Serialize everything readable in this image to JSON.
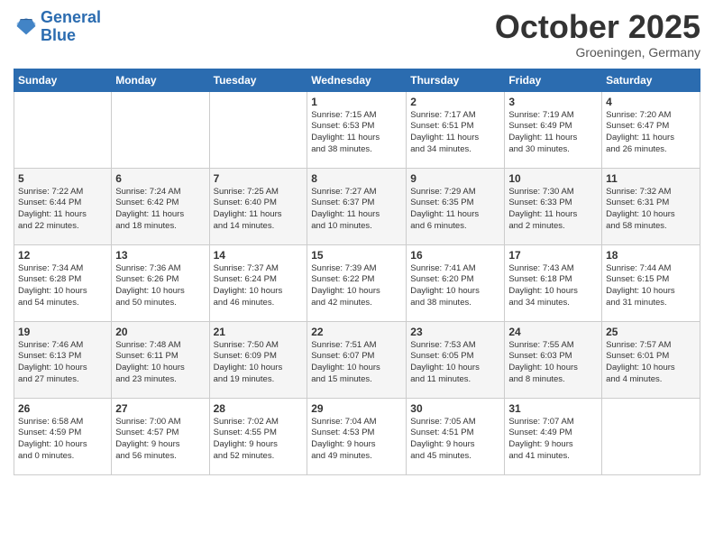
{
  "logo": {
    "line1": "General",
    "line2": "Blue"
  },
  "title": "October 2025",
  "subtitle": "Groeningen, Germany",
  "weekdays": [
    "Sunday",
    "Monday",
    "Tuesday",
    "Wednesday",
    "Thursday",
    "Friday",
    "Saturday"
  ],
  "weeks": [
    [
      {
        "day": "",
        "info": ""
      },
      {
        "day": "",
        "info": ""
      },
      {
        "day": "",
        "info": ""
      },
      {
        "day": "1",
        "info": "Sunrise: 7:15 AM\nSunset: 6:53 PM\nDaylight: 11 hours\nand 38 minutes."
      },
      {
        "day": "2",
        "info": "Sunrise: 7:17 AM\nSunset: 6:51 PM\nDaylight: 11 hours\nand 34 minutes."
      },
      {
        "day": "3",
        "info": "Sunrise: 7:19 AM\nSunset: 6:49 PM\nDaylight: 11 hours\nand 30 minutes."
      },
      {
        "day": "4",
        "info": "Sunrise: 7:20 AM\nSunset: 6:47 PM\nDaylight: 11 hours\nand 26 minutes."
      }
    ],
    [
      {
        "day": "5",
        "info": "Sunrise: 7:22 AM\nSunset: 6:44 PM\nDaylight: 11 hours\nand 22 minutes."
      },
      {
        "day": "6",
        "info": "Sunrise: 7:24 AM\nSunset: 6:42 PM\nDaylight: 11 hours\nand 18 minutes."
      },
      {
        "day": "7",
        "info": "Sunrise: 7:25 AM\nSunset: 6:40 PM\nDaylight: 11 hours\nand 14 minutes."
      },
      {
        "day": "8",
        "info": "Sunrise: 7:27 AM\nSunset: 6:37 PM\nDaylight: 11 hours\nand 10 minutes."
      },
      {
        "day": "9",
        "info": "Sunrise: 7:29 AM\nSunset: 6:35 PM\nDaylight: 11 hours\nand 6 minutes."
      },
      {
        "day": "10",
        "info": "Sunrise: 7:30 AM\nSunset: 6:33 PM\nDaylight: 11 hours\nand 2 minutes."
      },
      {
        "day": "11",
        "info": "Sunrise: 7:32 AM\nSunset: 6:31 PM\nDaylight: 10 hours\nand 58 minutes."
      }
    ],
    [
      {
        "day": "12",
        "info": "Sunrise: 7:34 AM\nSunset: 6:28 PM\nDaylight: 10 hours\nand 54 minutes."
      },
      {
        "day": "13",
        "info": "Sunrise: 7:36 AM\nSunset: 6:26 PM\nDaylight: 10 hours\nand 50 minutes."
      },
      {
        "day": "14",
        "info": "Sunrise: 7:37 AM\nSunset: 6:24 PM\nDaylight: 10 hours\nand 46 minutes."
      },
      {
        "day": "15",
        "info": "Sunrise: 7:39 AM\nSunset: 6:22 PM\nDaylight: 10 hours\nand 42 minutes."
      },
      {
        "day": "16",
        "info": "Sunrise: 7:41 AM\nSunset: 6:20 PM\nDaylight: 10 hours\nand 38 minutes."
      },
      {
        "day": "17",
        "info": "Sunrise: 7:43 AM\nSunset: 6:18 PM\nDaylight: 10 hours\nand 34 minutes."
      },
      {
        "day": "18",
        "info": "Sunrise: 7:44 AM\nSunset: 6:15 PM\nDaylight: 10 hours\nand 31 minutes."
      }
    ],
    [
      {
        "day": "19",
        "info": "Sunrise: 7:46 AM\nSunset: 6:13 PM\nDaylight: 10 hours\nand 27 minutes."
      },
      {
        "day": "20",
        "info": "Sunrise: 7:48 AM\nSunset: 6:11 PM\nDaylight: 10 hours\nand 23 minutes."
      },
      {
        "day": "21",
        "info": "Sunrise: 7:50 AM\nSunset: 6:09 PM\nDaylight: 10 hours\nand 19 minutes."
      },
      {
        "day": "22",
        "info": "Sunrise: 7:51 AM\nSunset: 6:07 PM\nDaylight: 10 hours\nand 15 minutes."
      },
      {
        "day": "23",
        "info": "Sunrise: 7:53 AM\nSunset: 6:05 PM\nDaylight: 10 hours\nand 11 minutes."
      },
      {
        "day": "24",
        "info": "Sunrise: 7:55 AM\nSunset: 6:03 PM\nDaylight: 10 hours\nand 8 minutes."
      },
      {
        "day": "25",
        "info": "Sunrise: 7:57 AM\nSunset: 6:01 PM\nDaylight: 10 hours\nand 4 minutes."
      }
    ],
    [
      {
        "day": "26",
        "info": "Sunrise: 6:58 AM\nSunset: 4:59 PM\nDaylight: 10 hours\nand 0 minutes."
      },
      {
        "day": "27",
        "info": "Sunrise: 7:00 AM\nSunset: 4:57 PM\nDaylight: 9 hours\nand 56 minutes."
      },
      {
        "day": "28",
        "info": "Sunrise: 7:02 AM\nSunset: 4:55 PM\nDaylight: 9 hours\nand 52 minutes."
      },
      {
        "day": "29",
        "info": "Sunrise: 7:04 AM\nSunset: 4:53 PM\nDaylight: 9 hours\nand 49 minutes."
      },
      {
        "day": "30",
        "info": "Sunrise: 7:05 AM\nSunset: 4:51 PM\nDaylight: 9 hours\nand 45 minutes."
      },
      {
        "day": "31",
        "info": "Sunrise: 7:07 AM\nSunset: 4:49 PM\nDaylight: 9 hours\nand 41 minutes."
      },
      {
        "day": "",
        "info": ""
      }
    ]
  ]
}
